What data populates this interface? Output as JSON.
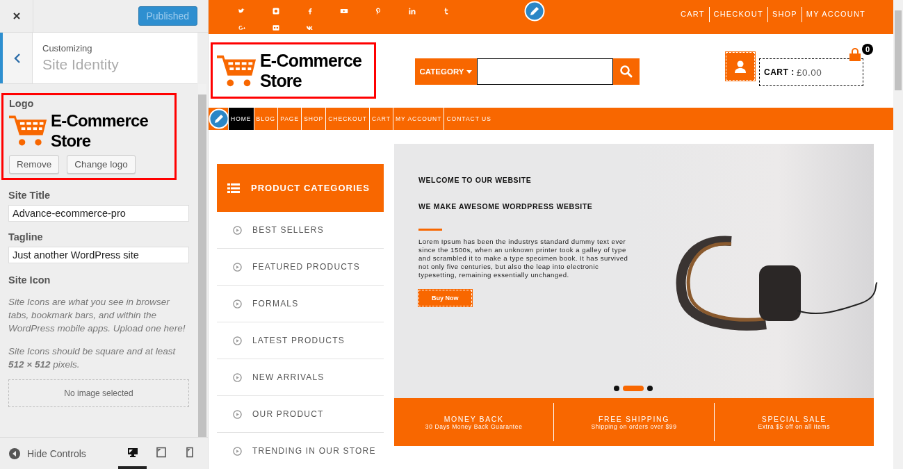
{
  "customizer": {
    "publish_button": "Published",
    "breadcrumb": "Customizing",
    "title": "Site Identity",
    "logo": {
      "label": "Logo",
      "lines": [
        "E-Commerce",
        "Store"
      ],
      "buttons": [
        "Remove",
        "Change logo"
      ]
    },
    "fields": [
      {
        "label": "Site Title",
        "value": "Advance-ecommerce-pro"
      },
      {
        "label": "Tagline",
        "value": "Just another WordPress site"
      }
    ],
    "site_icon": {
      "label": "Site Icon",
      "description": "Site Icons are what you see in browser tabs, bookmark bars, and within the WordPress mobile apps. Upload one here!",
      "note": "Site Icons should be square and at least **512 × 512** pixels.",
      "empty": "No image selected"
    },
    "hide_controls": "Hide Controls",
    "devices": [
      {
        "kind": "desktop",
        "selected": true
      },
      {
        "kind": "tablet",
        "selected": false
      },
      {
        "kind": "mobile",
        "selected": false
      }
    ]
  },
  "preview": {
    "social": [
      {
        "kind": "twitter"
      },
      {
        "kind": "instagram"
      },
      {
        "kind": "facebook"
      },
      {
        "kind": "youtube"
      },
      {
        "kind": "pinterest"
      },
      {
        "kind": "linkedin"
      },
      {
        "kind": "tumblr"
      },
      {
        "kind": "googleplus"
      },
      {
        "kind": "flickr"
      },
      {
        "kind": "vk"
      }
    ],
    "top_links": [
      "CART",
      "CHECKOUT",
      "SHOP",
      "MY ACCOUNT"
    ],
    "logo_lines": [
      "E-Commerce",
      "Store"
    ],
    "category": "CATEGORY",
    "cart": {
      "count": "0",
      "label": "CART :",
      "amount": "£0.00"
    },
    "nav": [
      {
        "label": "HOME",
        "selected": true
      },
      {
        "label": "BLOG",
        "selected": false
      },
      {
        "label": "PAGE",
        "selected": false
      },
      {
        "label": "SHOP",
        "selected": false
      },
      {
        "label": "CHECKOUT",
        "selected": false
      },
      {
        "label": "CART",
        "selected": false
      },
      {
        "label": "MY ACCOUNT",
        "selected": false
      },
      {
        "label": "CONTACT US",
        "selected": false
      }
    ],
    "categories": {
      "title": "PRODUCT CATEGORIES",
      "items": [
        "BEST SELLERS",
        "FEATURED PRODUCTS",
        "FORMALS",
        "LATEST PRODUCTS",
        "NEW ARRIVALS",
        "OUR PRODUCT",
        "TRENDING IN OUR STORE"
      ]
    },
    "slider": {
      "kicker": "WELCOME TO OUR WEBSITE",
      "heading": "WE MAKE AWESOME WORDPRESS WEBSITE",
      "body": "Lorem Ipsum has been the industrys standard dummy text ever since the 1500s, when an unknown printer took a galley of type and scrambled it to make a type specimen book. It has survived not only five centuries, but also the leap into electronic typesetting, remaining essentially unchanged.",
      "button": "Buy Now",
      "dots": [
        {
          "selected": false
        },
        {
          "selected": true
        },
        {
          "selected": false
        }
      ]
    },
    "features": [
      {
        "title": "MONEY BACK",
        "subtitle": "30 Days Money Back Guarantee"
      },
      {
        "title": "FREE SHIPPING",
        "subtitle": "Shipping on orders over $99"
      },
      {
        "title": "SPECIAL SALE",
        "subtitle": "Extra $5 off on all items"
      }
    ]
  }
}
